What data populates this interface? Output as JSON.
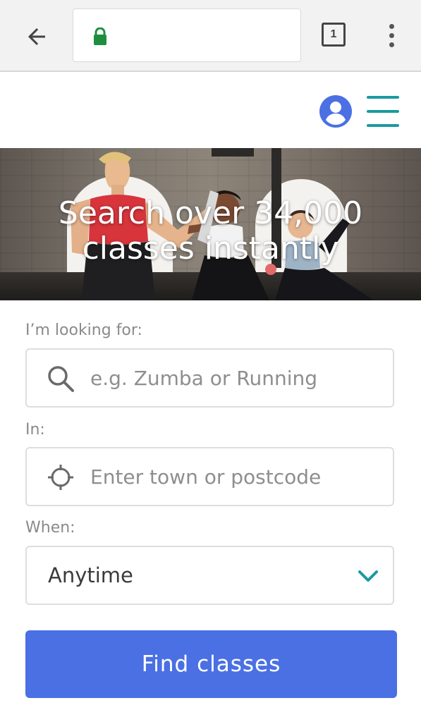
{
  "browser": {
    "back_icon": "arrow-left-icon",
    "lock_icon": "lock-icon",
    "url": "",
    "tab_count": "1",
    "menu_icon": "more-vert-icon",
    "lock_color": "#1e8e3e"
  },
  "header": {
    "account_icon": "account-circle-icon",
    "menu_icon": "hamburger-menu-icon",
    "account_color": "#4a70e4",
    "menu_color": "#1a9aa0"
  },
  "hero": {
    "title": "Search over 34,000 classes instantly"
  },
  "form": {
    "looking_for_label": "I’m looking for:",
    "looking_for_placeholder": "e.g. Zumba or Running",
    "in_label": "In:",
    "in_placeholder": "Enter town or postcode",
    "when_label": "When:",
    "when_value": "Anytime",
    "submit_label": "Find classes"
  },
  "colors": {
    "accent": "#4a70e4",
    "teal": "#1a9aa0"
  }
}
